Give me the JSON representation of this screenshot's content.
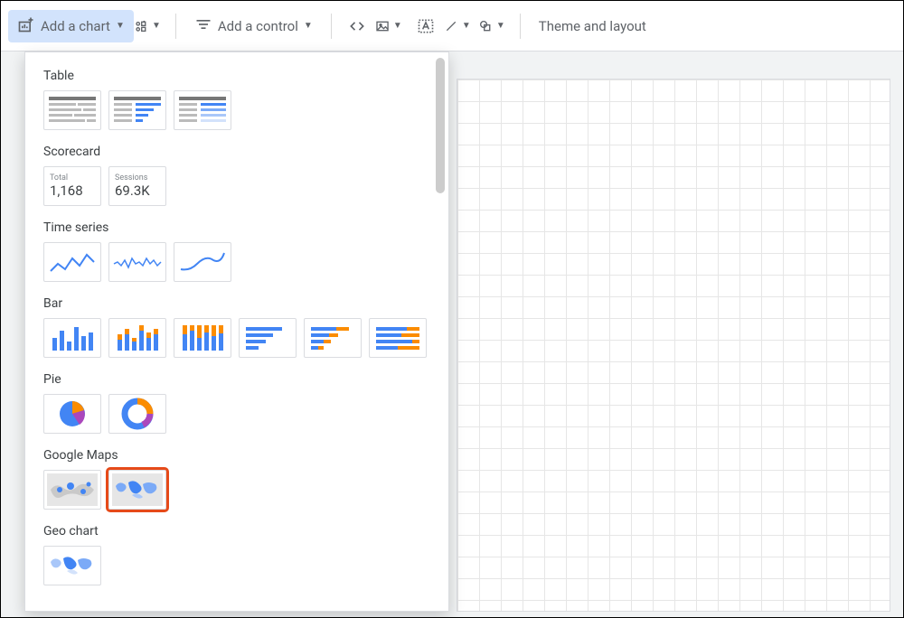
{
  "toolbar": {
    "add_chart_label": "Add a chart",
    "add_control_label": "Add a control",
    "theme_layout_label": "Theme and layout"
  },
  "chart_picker": {
    "sections": {
      "table": "Table",
      "scorecard": "Scorecard",
      "time_series": "Time series",
      "bar": "Bar",
      "pie": "Pie",
      "google_maps": "Google Maps",
      "geo_chart": "Geo chart"
    },
    "scorecards": [
      {
        "label": "Total",
        "value": "1,168"
      },
      {
        "label": "Sessions",
        "value": "69.3K"
      }
    ]
  }
}
